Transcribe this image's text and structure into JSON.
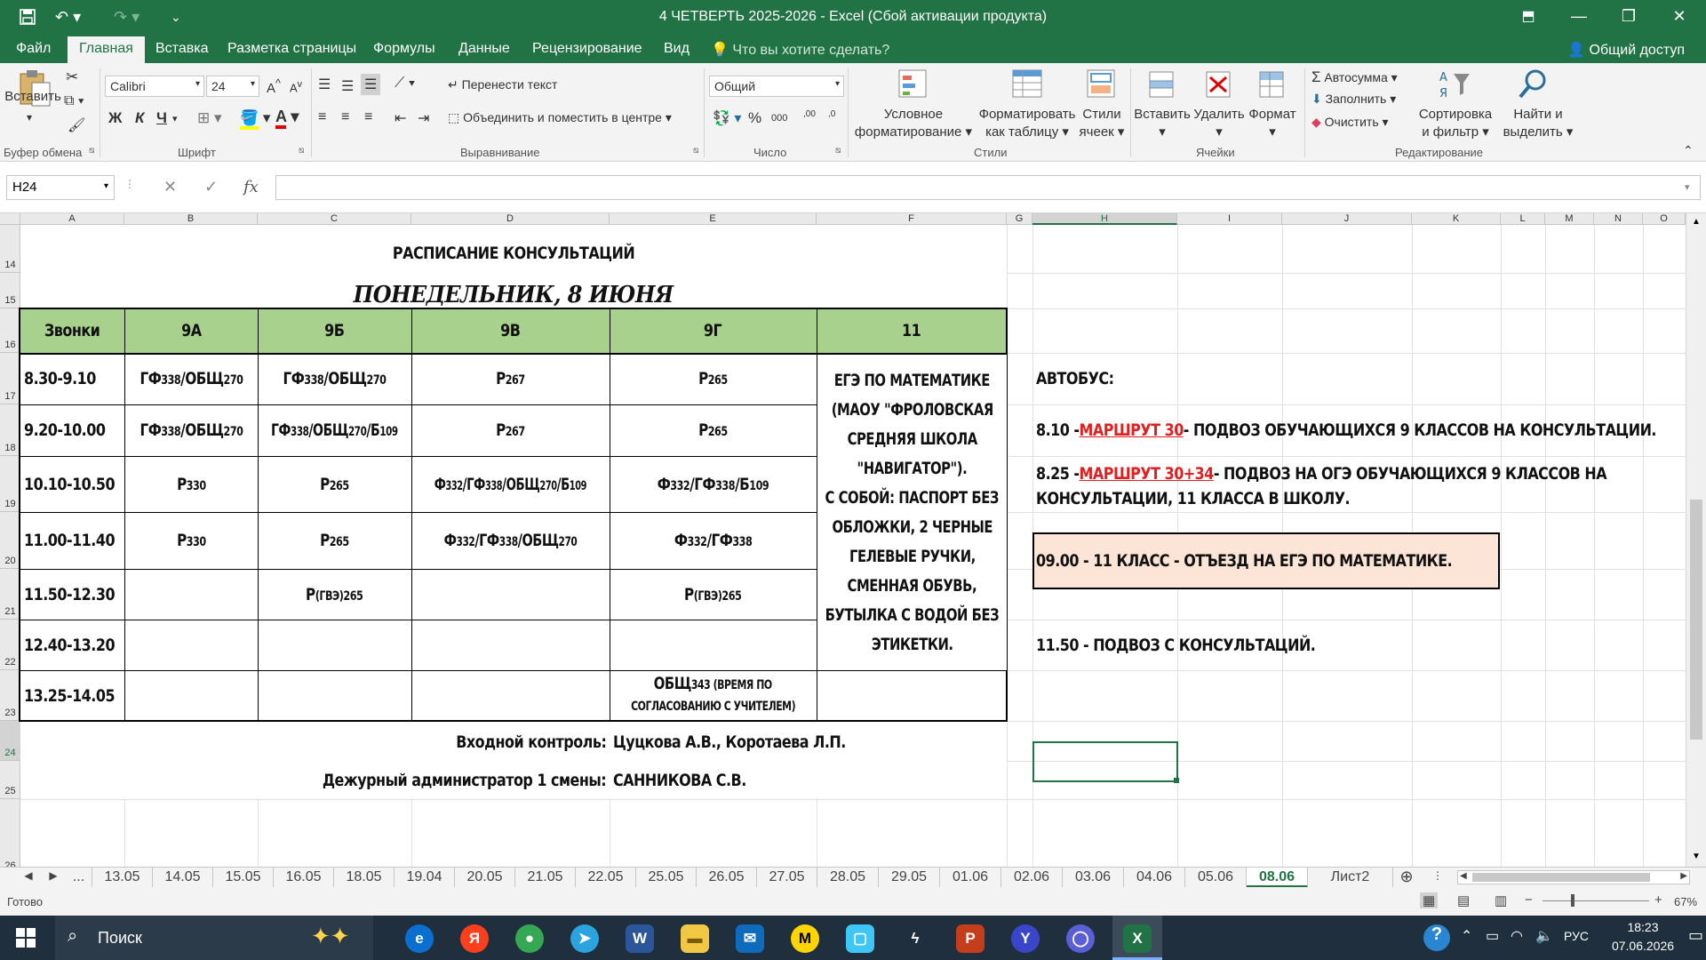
{
  "window": {
    "title": "4 ЧЕТВЕРТЬ 2025-2026 - Excel (Сбой активации продукта)"
  },
  "menu": {
    "tabs": [
      "Файл",
      "Главная",
      "Вставка",
      "Разметка страницы",
      "Формулы",
      "Данные",
      "Рецензирование",
      "Вид"
    ],
    "tell_me": "Что вы хотите сделать?",
    "share": "Общий доступ"
  },
  "ribbon": {
    "paste": "Вставить",
    "font_name": "Calibri",
    "font_size": "24",
    "bold": "Ж",
    "italic": "К",
    "underline": "Ч",
    "wrap_text": "Перенести текст",
    "merge_center": "Объединить и поместить в центре",
    "number_format": "Общий",
    "conditional": [
      "Условное",
      "форматирование"
    ],
    "format_table": [
      "Форматировать",
      "как таблицу"
    ],
    "cell_styles": [
      "Стили",
      "ячеек"
    ],
    "insert": "Вставить",
    "delete": "Удалить",
    "format": "Формат",
    "autosum": "Автосумма",
    "fill": "Заполнить",
    "clear": "Очистить",
    "sort": [
      "Сортировка",
      "и фильтр"
    ],
    "find": [
      "Найти и",
      "выделить"
    ],
    "groups": [
      "Буфер обмена",
      "Шрифт",
      "Выравнивание",
      "Число",
      "Стили",
      "Ячейки",
      "Редактирование"
    ]
  },
  "formula_bar": {
    "name_box": "H24",
    "fx": "fx",
    "value": ""
  },
  "columns": [
    "A",
    "B",
    "C",
    "D",
    "E",
    "F",
    "G",
    "H",
    "I",
    "J",
    "K",
    "L",
    "M",
    "N",
    "O"
  ],
  "rows": [
    "14",
    "15",
    "16",
    "17",
    "18",
    "19",
    "20",
    "21",
    "22",
    "23",
    "24",
    "25",
    "26"
  ],
  "schedule": {
    "title": "РАСПИСАНИЕ КОНСУЛЬТАЦИЙ",
    "date": "ПОНЕДЕЛЬНИК, 8 ИЮНЯ",
    "headers": [
      "Звонки",
      "9А",
      "9Б",
      "9В",
      "9Г",
      "11"
    ],
    "times": [
      "8.30-9.10",
      "9.20-10.00",
      "10.10-10.50",
      "11.00-11.40",
      "11.50-12.30",
      "12.40-13.20",
      "13.25-14.05"
    ],
    "r17": {
      "b": {
        "main": "ГФ",
        "sub1": "338",
        "main2": "/ОБЩ",
        "sub2": "270"
      },
      "c": {
        "main": "ГФ",
        "sub1": "338",
        "main2": "/ОБЩ",
        "sub2": "270"
      },
      "d": {
        "main": "Р",
        "sub1": "267"
      },
      "e": {
        "main": "Р",
        "sub1": "265"
      }
    },
    "r18": {
      "b": {
        "main": "ГФ",
        "sub1": "338",
        "main2": "/ОБЩ",
        "sub2": "270"
      },
      "c": {
        "main": "ГФ",
        "sub1": "338",
        "main2": "/ОБЩ",
        "sub2": "270",
        "main3": "/Б",
        "sub3": "109"
      },
      "d": {
        "main": "Р",
        "sub1": "267"
      },
      "e": {
        "main": "Р",
        "sub1": "265"
      }
    },
    "r19": {
      "b": {
        "main": "Р",
        "sub1": "330"
      },
      "c": {
        "main": "Р",
        "sub1": "265"
      },
      "d": {
        "main": "Ф",
        "sub1": "332",
        "main2": "/ГФ",
        "sub2": "338",
        "main3": "/ОБЩ",
        "sub3": "270",
        "main4": "/Б",
        "sub4": "109"
      },
      "e": {
        "main": "Ф",
        "sub1": "332",
        "main2": "/ГФ",
        "sub2": "338",
        "main3": "/Б",
        "sub3": "109"
      }
    },
    "r20": {
      "b": {
        "main": "Р",
        "sub1": "330"
      },
      "c": {
        "main": "Р",
        "sub1": "265"
      },
      "d": {
        "main": "Ф",
        "sub1": "332",
        "main2": "/ГФ",
        "sub2": "338",
        "main3": "/ОБЩ",
        "sub3": "270"
      },
      "e": {
        "main": "Ф",
        "sub1": "332",
        "main2": "/ГФ",
        "sub2": "338"
      }
    },
    "r21": {
      "c": {
        "main": "Р",
        "sub1": "(ГВЭ)265"
      },
      "e": {
        "main": "Р",
        "sub1": "(ГВЭ)265"
      }
    },
    "r23": {
      "e1": {
        "main": "ОБЩ",
        "sub1": "343 (ВРЕМЯ ПО"
      },
      "e2": "СОГЛАСОВАНИЮ С УЧИТЕЛЕМ)"
    },
    "f_note": [
      "ЕГЭ ПО МАТЕМАТИКЕ",
      "(МАОУ \"ФРОЛОВСКАЯ",
      "СРЕДНЯЯ ШКОЛА",
      "\"НАВИГАТОР\").",
      "С СОБОЙ: ПАСПОРТ БЕЗ",
      "ОБЛОЖКИ, 2 ЧЕРНЫЕ",
      "ГЕЛЕВЫЕ РУЧКИ,",
      "СМЕННАЯ ОБУВЬ,",
      "БУТЫЛКА С ВОДОЙ БЕЗ",
      "ЭТИКЕТКИ."
    ],
    "entry_label": "Входной контроль:",
    "entry_value": "Цуцкова А.В., Коротаева Л.П.",
    "admin_label": "Дежурный администратор 1 смены:",
    "admin_value": "САННИКОВА С.В."
  },
  "bus": {
    "title": "АВТОБУС:",
    "l1_pre": "8.10 - ",
    "l1_link": "МАРШРУТ 30",
    "l1_post": " - ПОДВОЗ ОБУЧАЮЩИХСЯ 9 КЛАССОВ НА КОНСУЛЬТАЦИИ.",
    "l2_pre": "8.25 - ",
    "l2_link": "МАРШРУТ 30+34",
    "l2_post": " - ПОДВОЗ НА ОГЭ ОБУЧАЮЩИХСЯ 9 КЛАССОВ НА",
    "l2_line2": "КОНСУЛЬТАЦИИ, 11 КЛАССА В ШКОЛУ.",
    "l3": "09.00 - 11 КЛАСС - ОТЪЕЗД НА ЕГЭ ПО МАТЕМАТИКЕ.",
    "l4": "11.50 - ПОДВОЗ С КОНСУЛЬТАЦИЙ."
  },
  "sheet_tabs": [
    "...",
    "13.05",
    "14.05",
    "15.05",
    "16.05",
    "18.05",
    "19.04",
    "20.05",
    "21.05",
    "22.05",
    "25.05",
    "26.05",
    "27.05",
    "28.05",
    "29.05",
    "01.06",
    "02.06",
    "03.06",
    "04.06",
    "05.06",
    "08.06",
    "Лист2"
  ],
  "active_sheet": "08.06",
  "status": {
    "ready": "Готово",
    "zoom": "67%"
  },
  "taskbar": {
    "search": "Поиск",
    "lang": "РУС",
    "time": "18:23",
    "date": "07.06.2026"
  },
  "colors": {
    "excel_green": "#217346",
    "header_fill": "#a9d18e",
    "highlight_fill": "#fce4d6",
    "link_red": "#e02020"
  }
}
